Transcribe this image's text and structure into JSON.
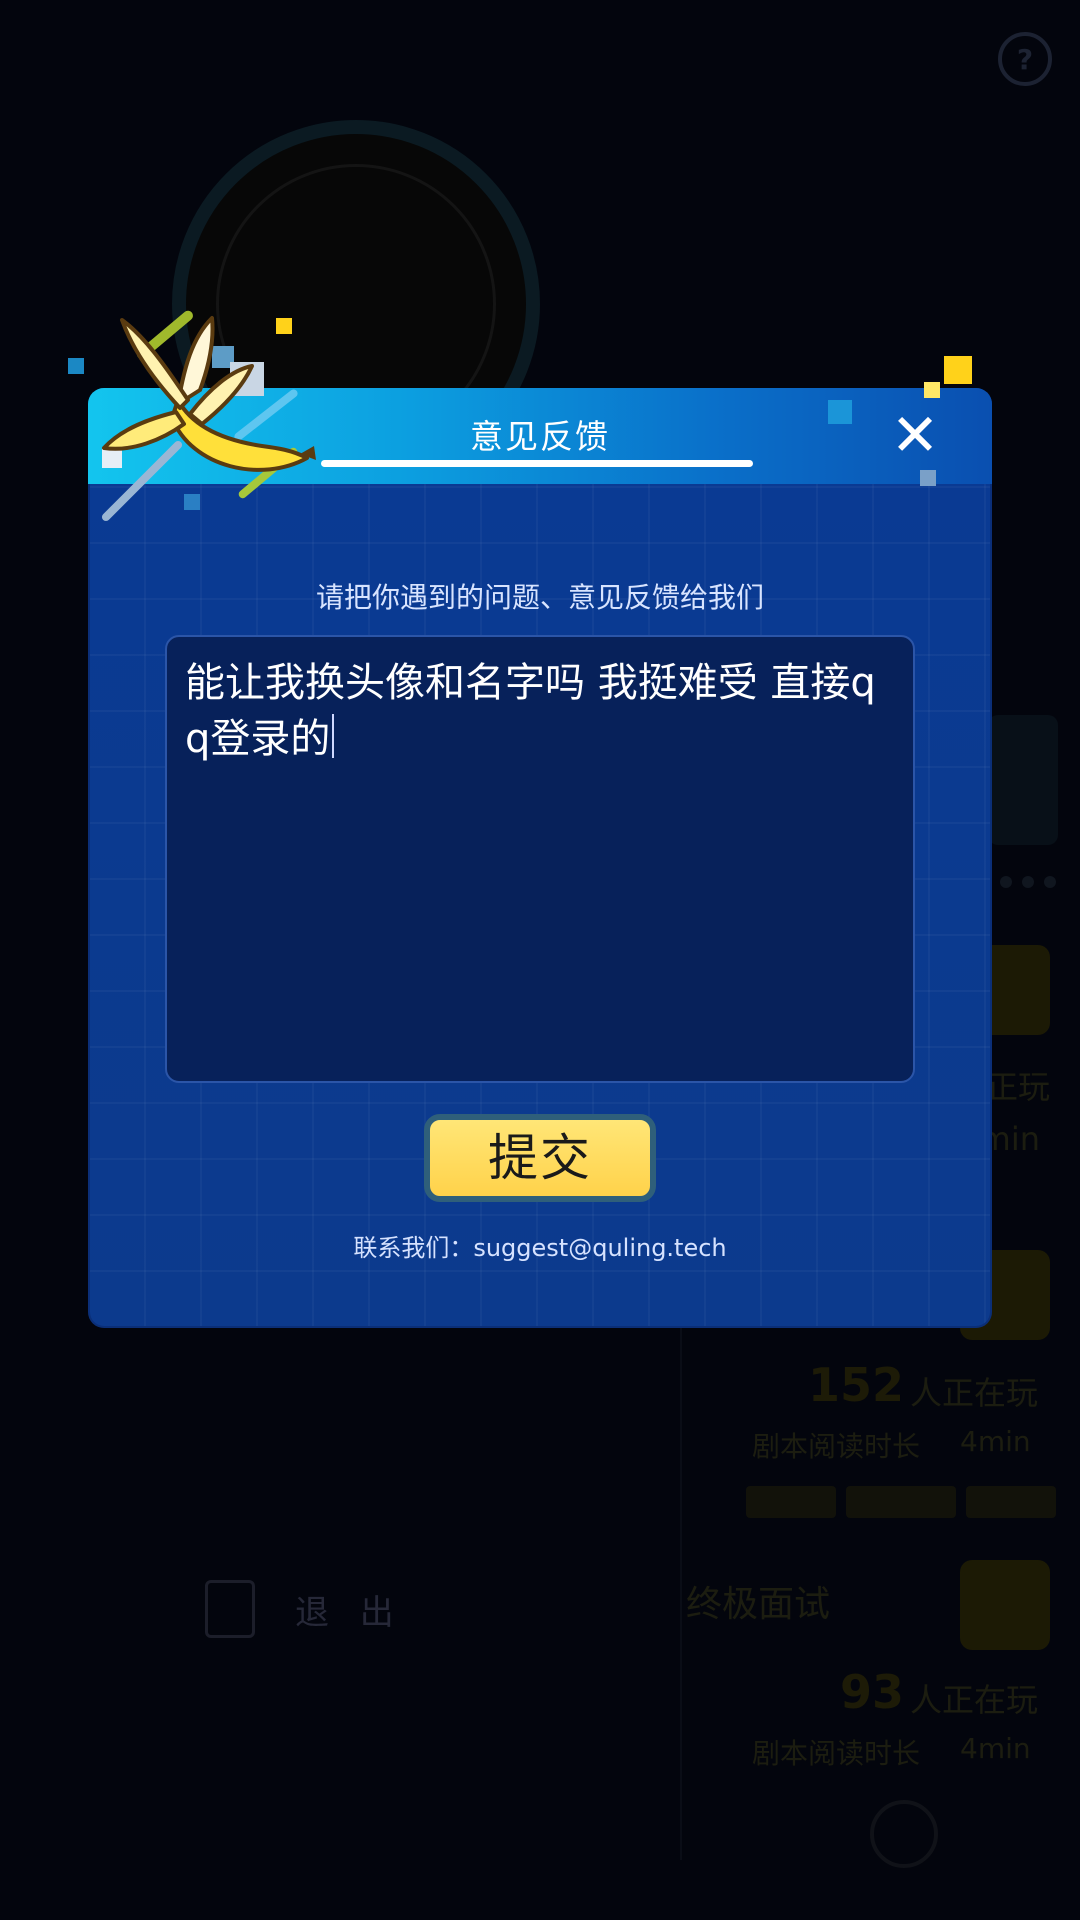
{
  "background": {
    "help_label": "",
    "counters": [
      {
        "count": "152",
        "label": "人正在玩"
      },
      {
        "count": "93",
        "label": "人正在玩"
      }
    ],
    "game_title": "终极面试",
    "exit_label": "退 出",
    "partial_labels": [
      "正玩",
      "min",
      "剧本阅读时长",
      "4min",
      "剧本阅读时长",
      "4min"
    ]
  },
  "dialog": {
    "title": "意见反馈",
    "close_symbol": "✕",
    "prompt": "请把你遇到的问题、意见反馈给我们",
    "feedback_text": "能让我换头像和名字吗 我挺难受 直接qq登录的",
    "submit_label": "提交",
    "contact": "联系我们：suggest@quling.tech"
  },
  "colors": {
    "dialog_bg": "#0b3a8f",
    "header_gradient_start": "#13c5ee",
    "header_gradient_end": "#0a4fb0",
    "submit_bg": "#ffd24a",
    "overlay": "#03050d"
  },
  "icons": [
    "help-icon",
    "close-icon",
    "banana-icon",
    "exit-icon",
    "bell-icon"
  ]
}
